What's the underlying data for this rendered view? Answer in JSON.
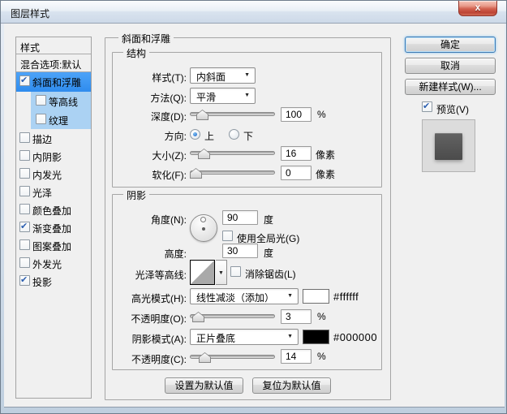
{
  "window": {
    "title": "图层样式",
    "close_glyph": "x"
  },
  "icons": {
    "chevron": "▼"
  },
  "sidebar": {
    "header": "样式",
    "blending_default": "混合选项:默认",
    "items": [
      {
        "label": "斜面和浮雕",
        "checked": true,
        "selected": true,
        "sub": false
      },
      {
        "label": "等高线",
        "checked": false,
        "selected": false,
        "sub": true
      },
      {
        "label": "纹理",
        "checked": false,
        "selected": false,
        "sub": true
      },
      {
        "label": "描边",
        "checked": false,
        "selected": false,
        "sub": false
      },
      {
        "label": "内阴影",
        "checked": false,
        "selected": false,
        "sub": false
      },
      {
        "label": "内发光",
        "checked": false,
        "selected": false,
        "sub": false
      },
      {
        "label": "光泽",
        "checked": false,
        "selected": false,
        "sub": false
      },
      {
        "label": "颜色叠加",
        "checked": false,
        "selected": false,
        "sub": false
      },
      {
        "label": "渐变叠加",
        "checked": true,
        "selected": false,
        "sub": false
      },
      {
        "label": "图案叠加",
        "checked": false,
        "selected": false,
        "sub": false
      },
      {
        "label": "外发光",
        "checked": false,
        "selected": false,
        "sub": false
      },
      {
        "label": "投影",
        "checked": true,
        "selected": false,
        "sub": false
      }
    ]
  },
  "panel": {
    "title": "斜面和浮雕",
    "structure": {
      "title": "结构",
      "style_label": "样式(T):",
      "style_value": "内斜面",
      "technique_label": "方法(Q):",
      "technique_value": "平滑",
      "depth_label": "深度(D):",
      "depth_value": "100",
      "depth_unit": "%",
      "direction_label": "方向:",
      "direction_up": "上",
      "direction_down": "下",
      "size_label": "大小(Z):",
      "size_value": "16",
      "size_unit": "像素",
      "soften_label": "软化(F):",
      "soften_value": "0",
      "soften_unit": "像素"
    },
    "shading": {
      "title": "阴影",
      "angle_label": "角度(N):",
      "angle_value": "90",
      "angle_unit": "度",
      "global_light_label": "使用全局光(G)",
      "altitude_label": "高度:",
      "altitude_value": "30",
      "altitude_unit": "度",
      "gloss_label": "光泽等高线:",
      "antialias_label": "消除锯齿(L)",
      "highlight_label": "高光模式(H):",
      "highlight_value": "线性减淡（添加）",
      "highlight_hex": "#ffffff",
      "opacity1_label": "不透明度(O):",
      "opacity1_value": "3",
      "opacity1_unit": "%",
      "shadow_label": "阴影模式(A):",
      "shadow_value": "正片叠底",
      "shadow_hex": "#000000",
      "opacity2_label": "不透明度(C):",
      "opacity2_value": "14",
      "opacity2_unit": "%"
    },
    "set_default_label": "设置为默认值",
    "reset_default_label": "复位为默认值"
  },
  "actions": {
    "ok": "确定",
    "cancel": "取消",
    "new_style": "新建样式(W)...",
    "preview": "预览(V)"
  },
  "colors": {
    "selection_blue": "#3b95f2",
    "sub_selection_blue": "#abd2f3",
    "highlight_swatch": "#ffffff",
    "shadow_swatch": "#000000"
  }
}
